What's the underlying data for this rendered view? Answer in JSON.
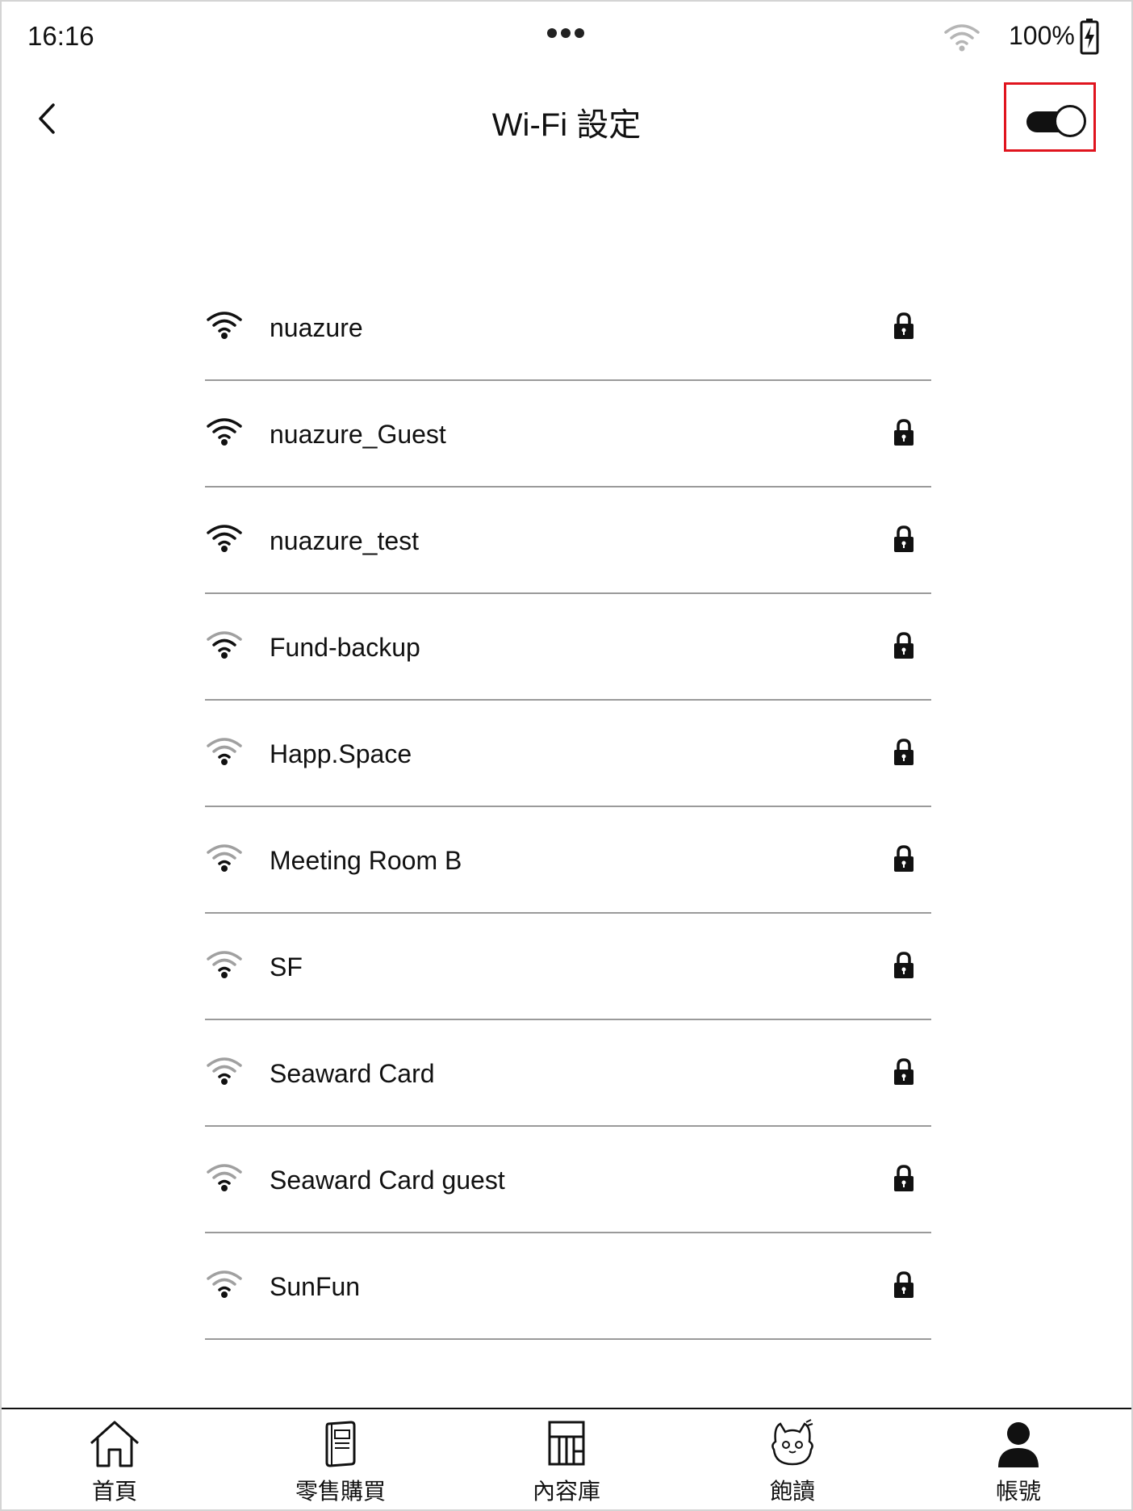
{
  "status_bar": {
    "time": "16:16",
    "battery_text": "100%",
    "icons": [
      "menu-dots-icon",
      "wifi-icon",
      "battery-charging-icon"
    ]
  },
  "header": {
    "title": "Wi-Fi 設定",
    "back_icon": "chevron-left-icon",
    "wifi_enabled": true
  },
  "networks": [
    {
      "name": "nuazure",
      "signal": "strong",
      "locked": true
    },
    {
      "name": "nuazure_Guest",
      "signal": "strong",
      "locked": true
    },
    {
      "name": "nuazure_test",
      "signal": "strong",
      "locked": true
    },
    {
      "name": "Fund-backup",
      "signal": "medium",
      "locked": true
    },
    {
      "name": "Happ.Space",
      "signal": "weak",
      "locked": true
    },
    {
      "name": "Meeting Room B",
      "signal": "weak",
      "locked": true
    },
    {
      "name": "SF",
      "signal": "weak",
      "locked": true
    },
    {
      "name": "Seaward Card",
      "signal": "weak",
      "locked": true
    },
    {
      "name": "Seaward Card guest",
      "signal": "weak",
      "locked": true
    },
    {
      "name": "SunFun",
      "signal": "weak",
      "locked": true
    }
  ],
  "bottom_nav": [
    {
      "label": "首頁",
      "icon": "home-icon"
    },
    {
      "label": "零售購買",
      "icon": "book-icon"
    },
    {
      "label": "內容庫",
      "icon": "library-icon"
    },
    {
      "label": "飽讀",
      "icon": "mascot-icon"
    },
    {
      "label": "帳號",
      "icon": "account-icon"
    }
  ],
  "colors": {
    "accent_highlight": "#e0141e",
    "text": "#111111",
    "divider": "#9a9a9a",
    "signal_inactive": "#a0a0a0"
  }
}
